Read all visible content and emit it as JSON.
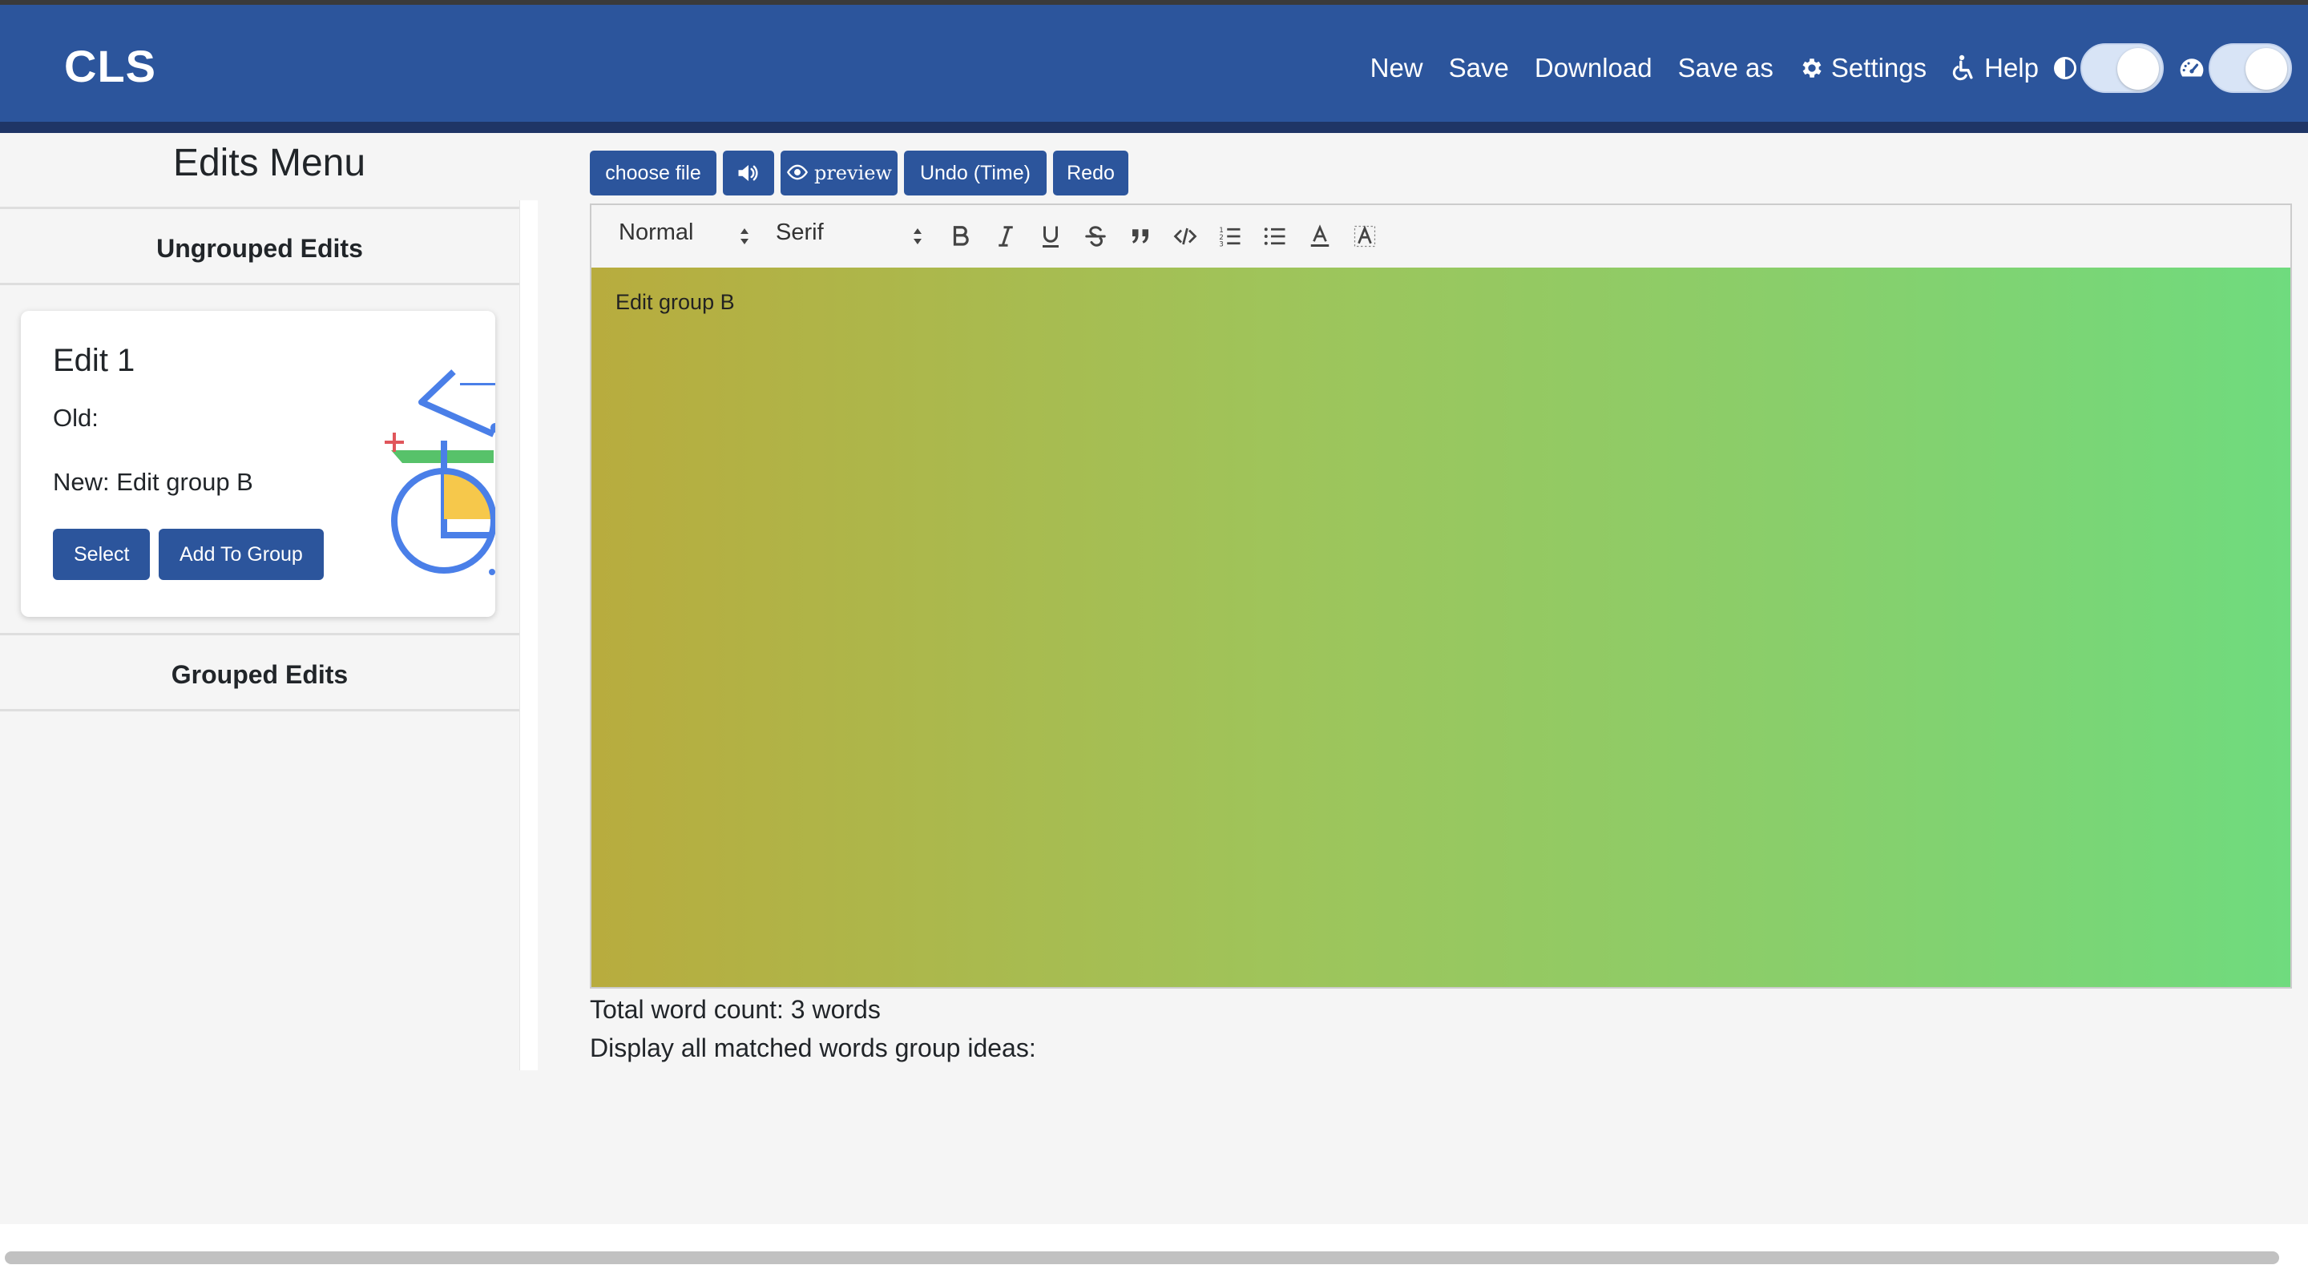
{
  "brand": "CLS",
  "nav": {
    "items": [
      {
        "label": "New"
      },
      {
        "label": "Save"
      },
      {
        "label": "Download"
      },
      {
        "label": "Save as"
      },
      {
        "label": "Settings",
        "icon": "gear-icon"
      },
      {
        "label": "Help",
        "icon": "accessibility-icon"
      }
    ],
    "toggles": [
      {
        "icon": "contrast-icon",
        "state": "on"
      },
      {
        "icon": "speedometer-icon",
        "state": "on"
      }
    ]
  },
  "sidebar": {
    "title": "Edits Menu",
    "ungrouped_heading": "Ungrouped Edits",
    "grouped_heading": "Grouped Edits",
    "card": {
      "title": "Edit 1",
      "old": "Old:",
      "new": "New: Edit group B",
      "select_label": "Select",
      "add_group_label": "Add To Group"
    }
  },
  "editor_buttons": {
    "choose_file": "choose file",
    "audio_icon": "speaker-icon",
    "preview": "preview",
    "undo": "Undo (Time)",
    "redo": "Redo"
  },
  "toolbar": {
    "heading_select": "Normal",
    "font_select": "Serif",
    "icons": [
      "bold-icon",
      "italic-icon",
      "underline-icon",
      "strike-icon",
      "blockquote-icon",
      "code-icon",
      "ordered-list-icon",
      "bullet-list-icon",
      "text-color-icon",
      "background-color-icon"
    ]
  },
  "editor": {
    "content": "Edit group B"
  },
  "footer_info": {
    "word_count": "Total word count: 3 words",
    "matched": "Display all matched words group ideas:"
  },
  "colors": {
    "primary": "#2c559c",
    "navbar": "#2c559c"
  }
}
